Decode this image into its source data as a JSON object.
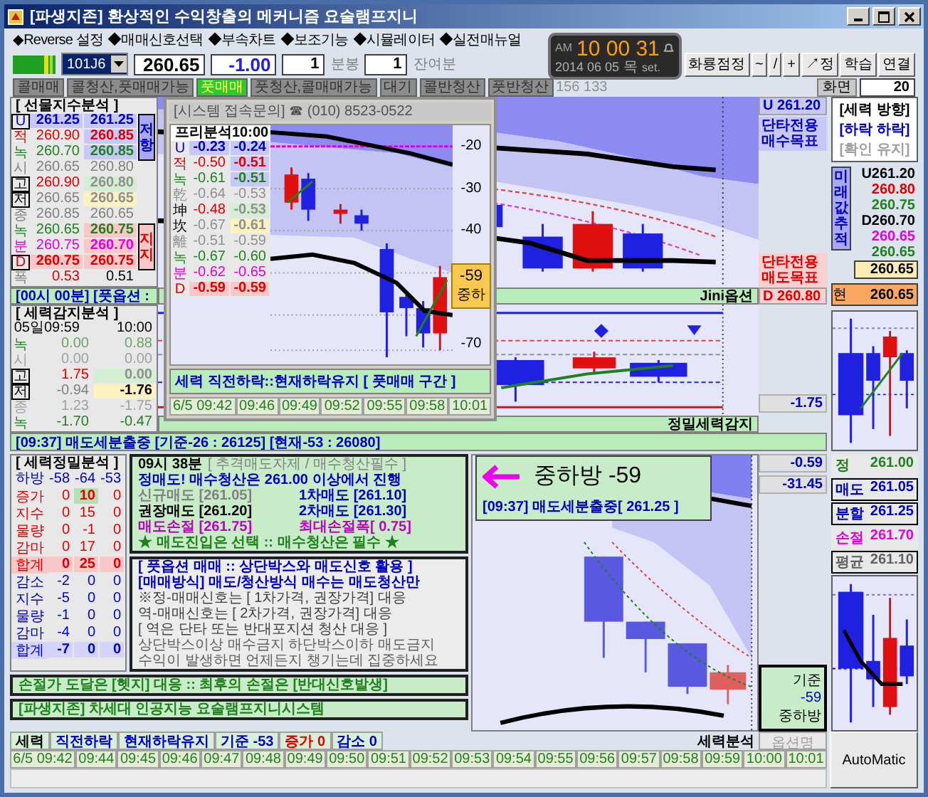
{
  "window": {
    "title": "[파생지존] 환상적인 수익창출의 메커니즘 요술램프지니"
  },
  "menu": [
    "◆Reverse 설정",
    "◆매매신호선택",
    "◆부속차트",
    "◆보조기능",
    "◆시뮬레이터",
    "◆실전매뉴얼"
  ],
  "toolbar": {
    "code": "101J6",
    "price": "260.65",
    "change": "-1.00",
    "bar_minutes": "1",
    "bar_label": "분봉",
    "remain": "1",
    "remain_label": "잔여분",
    "buttons": [
      "화룡점정",
      "~",
      "/",
      "+",
      "↗정",
      "학습",
      "연결"
    ]
  },
  "clock": {
    "ampm": "AM",
    "time": "10 00 31",
    "date": "2014 06 05",
    "weekday": "목",
    "set": "set."
  },
  "signals": [
    {
      "label": "콜매매",
      "on": false
    },
    {
      "label": "콜청산,풋매매가능",
      "on": false
    },
    {
      "label": "풋매매",
      "on": true
    },
    {
      "label": "풋청산,콜매매가능",
      "on": false
    },
    {
      "label": "대기",
      "on": false
    },
    {
      "label": "콜반청산",
      "on": false
    },
    {
      "label": "풋반청산",
      "on": false
    }
  ],
  "signal_count": "156 133",
  "screen": {
    "label": "화면",
    "value": "20"
  },
  "futures_analysis": {
    "title": "[ 선물지수분석 ]",
    "rows": [
      {
        "label": "U",
        "color": "#0000c0",
        "boxed": true,
        "cells": [
          {
            "text": "261.25",
            "color": "#0000c0",
            "kind": "resist"
          },
          {
            "text": "261.25",
            "color": "#0000c0",
            "kind": "resist"
          }
        ],
        "tag": {
          "text": "저항",
          "kind": "resist"
        }
      },
      {
        "label": "적",
        "color": "#e00000",
        "boxed": false,
        "cells": [
          {
            "text": "260.90",
            "color": "#e00000",
            "kind": "plain"
          },
          {
            "text": "260.85",
            "color": "#e00000",
            "kind": "resist"
          }
        ]
      },
      {
        "label": "녹",
        "color": "#208020",
        "boxed": false,
        "cells": [
          {
            "text": "260.70",
            "color": "#208020",
            "kind": "plain"
          },
          {
            "text": "260.85",
            "color": "#208020",
            "kind": "resist"
          }
        ]
      },
      {
        "label": "시",
        "color": "#808080",
        "boxed": false,
        "cells": [
          {
            "text": "260.65",
            "color": "#808080",
            "kind": "plain"
          },
          {
            "text": "260.80",
            "color": "#808080",
            "kind": "plain"
          }
        ]
      },
      {
        "label": "고",
        "color": "#000000",
        "boxed": true,
        "cells": [
          {
            "text": "260.90",
            "color": "#e00000",
            "kind": "plain"
          },
          {
            "text": "260.80",
            "color": "#909090",
            "kind": "high"
          }
        ]
      },
      {
        "label": "저",
        "color": "#000000",
        "boxed": true,
        "cells": [
          {
            "text": "260.65",
            "color": "#808080",
            "kind": "plain"
          },
          {
            "text": "260.65",
            "color": "#909090",
            "kind": "low"
          }
        ]
      },
      {
        "label": "종",
        "color": "#808080",
        "boxed": false,
        "cells": [
          {
            "text": "260.85",
            "color": "#808080",
            "kind": "plain"
          },
          {
            "text": "260.65",
            "color": "#808080",
            "kind": "plain"
          }
        ]
      },
      {
        "label": "녹",
        "color": "#208020",
        "boxed": false,
        "cells": [
          {
            "text": "260.65",
            "color": "#208020",
            "kind": "plain"
          },
          {
            "text": "260.75",
            "color": "#208020",
            "kind": "support"
          }
        ],
        "tag": {
          "text": "지지",
          "kind": "support"
        }
      },
      {
        "label": "분",
        "color": "#e000e0",
        "boxed": false,
        "cells": [
          {
            "text": "260.75",
            "color": "#e000e0",
            "kind": "plain"
          },
          {
            "text": "260.70",
            "color": "#e000e0",
            "kind": "support"
          }
        ]
      },
      {
        "label": "D",
        "color": "#e00000",
        "boxed": true,
        "cells": [
          {
            "text": "260.75",
            "color": "#e00000",
            "kind": "support"
          },
          {
            "text": "260.75",
            "color": "#e00000",
            "kind": "support"
          }
        ]
      },
      {
        "label": "폭",
        "color": "#808080",
        "boxed": false,
        "cells": [
          {
            "text": "0.53",
            "color": "#e00000",
            "kind": "plain"
          },
          {
            "text": "0.51",
            "color": "#000000",
            "kind": "plain"
          }
        ]
      }
    ]
  },
  "put_bar": "[00시 00분] [풋옵션 :",
  "force_detect": {
    "title": "[ 세력감지분석 ]",
    "header": [
      "05일09:59",
      "10:00"
    ],
    "rows": [
      {
        "label": "녹",
        "color": "#208020",
        "boxed": false,
        "cells": [
          {
            "text": "0.00",
            "color": "#70a070",
            "kind": "plain"
          },
          {
            "text": "0.88",
            "color": "#70a070",
            "kind": "plain"
          }
        ]
      },
      {
        "label": "시",
        "color": "#a0a0a0",
        "boxed": false,
        "cells": [
          {
            "text": "0.00",
            "color": "#a0a0a0",
            "kind": "plain"
          },
          {
            "text": "0.00",
            "color": "#a0a0a0",
            "kind": "plain"
          }
        ]
      },
      {
        "label": "고",
        "color": "#000000",
        "boxed": true,
        "cells": [
          {
            "text": "1.75",
            "color": "#e00000",
            "kind": "plain"
          },
          {
            "text": "0.00",
            "color": "#909090",
            "kind": "high"
          }
        ]
      },
      {
        "label": "저",
        "color": "#000000",
        "boxed": true,
        "cells": [
          {
            "text": "-0.94",
            "color": "#808080",
            "kind": "plain"
          },
          {
            "text": "-1.76",
            "color": "#000000",
            "kind": "low"
          }
        ]
      },
      {
        "label": "종",
        "color": "#a0a0a0",
        "boxed": false,
        "cells": [
          {
            "text": "1.23",
            "color": "#a0a0a0",
            "kind": "plain"
          },
          {
            "text": "-1.75",
            "color": "#a0a0a0",
            "kind": "plain"
          }
        ]
      },
      {
        "label": "녹",
        "color": "#208020",
        "boxed": false,
        "cells": [
          {
            "text": "-1.70",
            "color": "#208020",
            "kind": "plain"
          },
          {
            "text": "-0.47",
            "color": "#208020",
            "kind": "plain"
          }
        ]
      }
    ]
  },
  "popup": {
    "title": "[시스템 접속문의] ☎ (010) 8523-0522",
    "table_title": "프리분석10:00",
    "rows": [
      {
        "label": "U",
        "color": "#0000c0",
        "boxed": false,
        "cells": [
          {
            "text": "-0.23",
            "color": "#0000c0",
            "kind": "resist"
          },
          {
            "text": "-0.24",
            "color": "#0000c0",
            "kind": "resist"
          }
        ]
      },
      {
        "label": "적",
        "color": "#e00000",
        "boxed": false,
        "cells": [
          {
            "text": "-0.50",
            "color": "#e00000",
            "kind": "plain"
          },
          {
            "text": "-0.51",
            "color": "#e00000",
            "kind": "resist"
          }
        ]
      },
      {
        "label": "녹",
        "color": "#208020",
        "boxed": false,
        "cells": [
          {
            "text": "-0.61",
            "color": "#208020",
            "kind": "plain"
          },
          {
            "text": "-0.51",
            "color": "#208020",
            "kind": "resist"
          }
        ]
      },
      {
        "label": "乾",
        "color": "#909090",
        "boxed": false,
        "cells": [
          {
            "text": "-0.64",
            "color": "#909090",
            "kind": "plain"
          },
          {
            "text": "-0.53",
            "color": "#909090",
            "kind": "plain"
          }
        ]
      },
      {
        "label": "坤",
        "color": "#000000",
        "boxed": false,
        "cells": [
          {
            "text": "-0.48",
            "color": "#e00000",
            "kind": "plain"
          },
          {
            "text": "-0.53",
            "color": "#909090",
            "kind": "high"
          }
        ]
      },
      {
        "label": "坎",
        "color": "#000000",
        "boxed": false,
        "cells": [
          {
            "text": "-0.67",
            "color": "#909090",
            "kind": "plain"
          },
          {
            "text": "-0.61",
            "color": "#909090",
            "kind": "low"
          }
        ]
      },
      {
        "label": "離",
        "color": "#909090",
        "boxed": false,
        "cells": [
          {
            "text": "-0.51",
            "color": "#909090",
            "kind": "plain"
          },
          {
            "text": "-0.59",
            "color": "#909090",
            "kind": "plain"
          }
        ]
      },
      {
        "label": "녹",
        "color": "#208020",
        "boxed": false,
        "cells": [
          {
            "text": "-0.67",
            "color": "#208020",
            "kind": "plain"
          },
          {
            "text": "-0.60",
            "color": "#208020",
            "kind": "plain"
          }
        ]
      },
      {
        "label": "분",
        "color": "#e000e0",
        "boxed": false,
        "cells": [
          {
            "text": "-0.62",
            "color": "#e000e0",
            "kind": "plain"
          },
          {
            "text": "-0.65",
            "color": "#e000e0",
            "kind": "plain"
          }
        ]
      },
      {
        "label": "D",
        "color": "#e00000",
        "boxed": false,
        "cells": [
          {
            "text": "-0.59",
            "color": "#e00000",
            "kind": "support"
          },
          {
            "text": "-0.59",
            "color": "#e00000",
            "kind": "support"
          }
        ]
      }
    ],
    "ticks": [
      "-20",
      "-30",
      "-40",
      "-70"
    ],
    "marker": {
      "value": "-59",
      "label": "중하"
    },
    "status": "세력 직전하락::현재하락유지 [ 풋매매 구간 ]",
    "times": [
      "6/5 09:42",
      "09:46",
      "09:49",
      "09:52",
      "09:55",
      "09:58",
      "10:01"
    ]
  },
  "targets": {
    "buy_value": "U 261.20",
    "buy_note": "단타전용 매수목표",
    "sell_note": "단타전용 매도목표",
    "sell_value": "D 260.80"
  },
  "chart_label": "Jini옵션",
  "lower_chart": {
    "reading": "-1.75",
    "label": "정밀세력감지"
  },
  "direction": {
    "title": "[세력 방향]",
    "lines": [
      {
        "text": "[하락 하락]",
        "color": "#0000c0"
      },
      {
        "text": "[확인 유지]",
        "color": "#a0a0a0"
      }
    ]
  },
  "future": {
    "label": "미래값추적",
    "values": [
      {
        "text": "U261.20",
        "color": "#000000",
        "kind": "plain"
      },
      {
        "text": "260.80",
        "color": "#e00000",
        "kind": "plain"
      },
      {
        "text": "260.75",
        "color": "#208020",
        "kind": "plain"
      },
      {
        "text": "D260.70",
        "color": "#000000",
        "kind": "plain"
      },
      {
        "text": "260.65",
        "color": "#e000e0",
        "kind": "plain"
      },
      {
        "text": "260.65",
        "color": "#208020",
        "kind": "plain"
      },
      {
        "text": "260.65",
        "color": "#000000",
        "kind": "current"
      }
    ]
  },
  "current": {
    "label": "현",
    "value": "260.65"
  },
  "alert_bar": "[09:37] 매도세분출중 [기준-26 : 26125] [현재-53 : 26080]",
  "precision": {
    "title": "[ 세력정밀분석 ]",
    "header": [
      "하방",
      "-58",
      "-64",
      "-53"
    ],
    "rows": [
      {
        "label": "증가",
        "color": "#e00000",
        "kind": "plain",
        "cells": [
          {
            "text": "0",
            "color": "#e00000",
            "kind": "plain"
          },
          {
            "text": "10",
            "color": "#e00000",
            "kind": "peak"
          },
          {
            "text": "0",
            "color": "#e00000",
            "kind": "plain"
          }
        ]
      },
      {
        "label": "지수",
        "color": "#e00000",
        "kind": "plain",
        "cells": [
          {
            "text": "0",
            "color": "#e00000",
            "kind": "plain"
          },
          {
            "text": "15",
            "color": "#e00000",
            "kind": "plain"
          },
          {
            "text": "0",
            "color": "#e00000",
            "kind": "plain"
          }
        ]
      },
      {
        "label": "물량",
        "color": "#e00000",
        "kind": "plain",
        "cells": [
          {
            "text": "0",
            "color": "#e00000",
            "kind": "plain"
          },
          {
            "text": "-1",
            "color": "#e00000",
            "kind": "plain"
          },
          {
            "text": "0",
            "color": "#e00000",
            "kind": "plain"
          }
        ]
      },
      {
        "label": "감마",
        "color": "#e00000",
        "kind": "plain",
        "cells": [
          {
            "text": "0",
            "color": "#e00000",
            "kind": "plain"
          },
          {
            "text": "17",
            "color": "#e00000",
            "kind": "plain"
          },
          {
            "text": "0",
            "color": "#e00000",
            "kind": "plain"
          }
        ]
      },
      {
        "label": "합계",
        "color": "#e00000",
        "kind": "rise_total",
        "cells": [
          {
            "text": "0",
            "color": "#e00000",
            "kind": "plain"
          },
          {
            "text": "25",
            "color": "#e00000",
            "kind": "plain"
          },
          {
            "text": "0",
            "color": "#e00000",
            "kind": "plain"
          }
        ]
      },
      {
        "label": "감소",
        "color": "#0000c0",
        "kind": "plain",
        "cells": [
          {
            "text": "-2",
            "color": "#0000c0",
            "kind": "plain"
          },
          {
            "text": "0",
            "color": "#0000c0",
            "kind": "plain"
          },
          {
            "text": "0",
            "color": "#0000c0",
            "kind": "plain"
          }
        ]
      },
      {
        "label": "지수",
        "color": "#0000c0",
        "kind": "plain",
        "cells": [
          {
            "text": "-5",
            "color": "#0000c0",
            "kind": "plain"
          },
          {
            "text": "0",
            "color": "#0000c0",
            "kind": "plain"
          },
          {
            "text": "0",
            "color": "#0000c0",
            "kind": "plain"
          }
        ]
      },
      {
        "label": "물량",
        "color": "#0000c0",
        "kind": "plain",
        "cells": [
          {
            "text": "-1",
            "color": "#0000c0",
            "kind": "plain"
          },
          {
            "text": "0",
            "color": "#0000c0",
            "kind": "plain"
          },
          {
            "text": "0",
            "color": "#0000c0",
            "kind": "plain"
          }
        ]
      },
      {
        "label": "감마",
        "color": "#0000c0",
        "kind": "plain",
        "cells": [
          {
            "text": "-4",
            "color": "#0000c0",
            "kind": "plain"
          },
          {
            "text": "0",
            "color": "#0000c0",
            "kind": "plain"
          },
          {
            "text": "0",
            "color": "#0000c0",
            "kind": "plain"
          }
        ]
      },
      {
        "label": "합계",
        "color": "#0000c0",
        "kind": "fall_total",
        "cells": [
          {
            "text": "-7",
            "color": "#0000c0",
            "kind": "plain"
          },
          {
            "text": "0",
            "color": "#0000c0",
            "kind": "plain"
          },
          {
            "text": "0",
            "color": "#0000c0",
            "kind": "plain"
          }
        ]
      }
    ]
  },
  "advice": {
    "heading": "09시 38분",
    "heading_note": "[ 추격매도자제 / 매수청산필수 ]",
    "lead": "정매도! 매수청산은 261.00 이상에서 진행",
    "prices": [
      {
        "text": "신규매도 [261.05]",
        "color": "#808080"
      },
      {
        "text": "1차매도 [261.10]",
        "color": "#0000c0"
      },
      {
        "text": "권장매도 [261.20]",
        "color": "#000000"
      },
      {
        "text": "2차매도 [261.30]",
        "color": "#0000c0"
      },
      {
        "text": "매도손절 [261.75]",
        "color": "#c000c0"
      },
      {
        "text": "최대손절폭[ 0.75]",
        "color": "#c000c0"
      }
    ],
    "footer": "★ 매도진입은 선택 :: 매수청산은 필수 ★"
  },
  "method": {
    "lines": [
      {
        "text": "[ 풋옵션 매매 :: 상단박스와 매도신호 활용 ]",
        "color": "#0000c0"
      },
      {
        "text": "[매매방식] 매도/청산방식 매수는 매도청산만",
        "color": "#0000c0"
      },
      {
        "text": "※정-매매신호는 [ 1차가격, 권장가격] 대응",
        "color": "#404040"
      },
      {
        "text": "역-매매신호는 [ 2차가격, 권장가격] 대응",
        "color": "#404040"
      },
      {
        "text": "[ 역은 단타 또는 반대포지션 청산 대응 ]",
        "color": "#404040"
      },
      {
        "text": "상단박스이상 매수금지  하단박스이하 매도금지",
        "color": "#606060"
      },
      {
        "text": "수익이 발생하면 언제든지 챙기는데 집중하세요",
        "color": "#606060"
      }
    ]
  },
  "notices": [
    "손절가 도달은 [헷지] 대응 :: 최후의 손절은 [반대신호발생]",
    "[파생지존] 차세대 인공지능 요술램프지니시스템"
  ],
  "overlay": {
    "title": "중하방 -59",
    "note": "[09:37] 매도세분출중[ 261.25 ]"
  },
  "readings": [
    "-0.59",
    "-31.45"
  ],
  "basis_box": {
    "title": "기준",
    "value": "-59",
    "label": "중하방"
  },
  "orders": [
    {
      "label": "정",
      "value": "261.00",
      "color": "#208020",
      "boxed": false
    },
    {
      "label": "매도",
      "value": "261.05",
      "color": "#0000c0",
      "boxed": true
    },
    {
      "label": "분할",
      "value": "261.25",
      "color": "#0000c0",
      "boxed": true
    },
    {
      "label": "손절",
      "value": "261.70",
      "color": "#e000e0",
      "boxed": false
    },
    {
      "label": "평균",
      "value": "261.10",
      "color": "#606060",
      "boxed": true
    }
  ],
  "status": [
    {
      "text": "세력",
      "color": "#000000"
    },
    {
      "text": "직전하락",
      "color": "#0000c0"
    },
    {
      "text": "현재하락유지",
      "color": "#0000c0"
    },
    {
      "text": "기준 -53",
      "color": "#0000c0"
    },
    {
      "text": "증가 0",
      "color": "#e00000"
    },
    {
      "text": "감소 0",
      "color": "#0000c0"
    }
  ],
  "status_label": "세력분석",
  "option_label": "옵션명",
  "times": [
    "6/5 09:42",
    "09:44",
    "09:45",
    "09:46",
    "09:47",
    "09:48",
    "09:49",
    "09:50",
    "09:51",
    "09:52",
    "09:53",
    "09:54",
    "09:55",
    "09:56",
    "09:57",
    "09:58",
    "09:59",
    "10:00",
    "10:01"
  ],
  "auto_button": "AutoMatic"
}
